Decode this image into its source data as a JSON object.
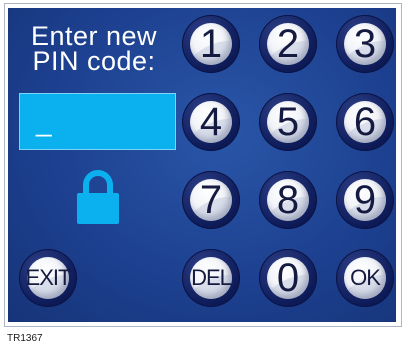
{
  "prompt": {
    "line1": "Enter new",
    "line2": "PIN code:"
  },
  "pin_field": {
    "value": "_"
  },
  "lock": {
    "icon": "lock-icon",
    "color": "#0ab1ee"
  },
  "keypad": {
    "keys": [
      "1",
      "2",
      "3",
      "4",
      "5",
      "6",
      "7",
      "8",
      "9",
      "DEL",
      "0",
      "OK"
    ]
  },
  "exit_label": "EXIT",
  "footer_code": "TR1367",
  "colors": {
    "panel": "#1c3f8e",
    "field": "#0ab1ee",
    "key_ring": "#0f1d5c",
    "key_face": "#f1f3f8"
  }
}
